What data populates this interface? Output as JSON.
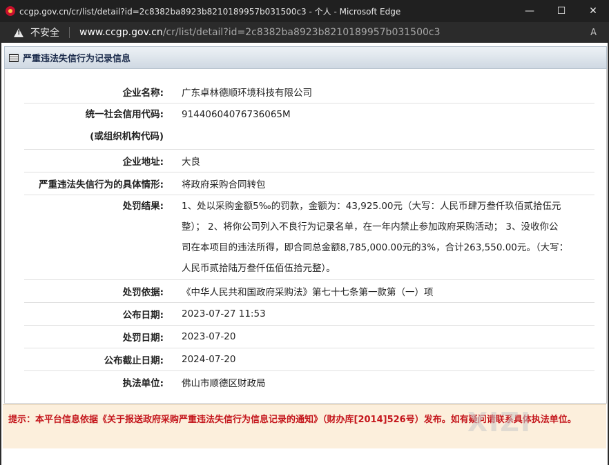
{
  "window": {
    "title": "ccgp.gov.cn/cr/list/detail?id=2c8382ba8923b8210189957b031500c3 - 个人 - Microsoft Edge",
    "minimize": "—",
    "maximize": "☐",
    "close": "✕"
  },
  "address_bar": {
    "security_text": "不安全",
    "url_host": "www.ccgp.gov.cn",
    "url_path": "/cr/list/detail?id=2c8382ba8923b8210189957b031500c3",
    "reader_icon": "A"
  },
  "panel": {
    "title": "严重违法失信行为记录信息"
  },
  "fields": {
    "company_label": "企业名称:",
    "company_value": "广东卓林德顺环境科技有限公司",
    "credit_label_1": "统一社会信用代码:",
    "credit_label_2": "(或组织机构代码)",
    "credit_value": "91440604076736065M",
    "address_label": "企业地址:",
    "address_value": "大良",
    "situation_label": "严重违法失信行为的具体情形:",
    "situation_value": "将政府采购合同转包",
    "result_label": "处罚结果:",
    "result_lines": [
      "1、处以采购金额5‰的罚款，金额为：43,925.00元（大写：人民币肆万叁仟玖佰贰拾伍元",
      "整）；  2、将你公司列入不良行为记录名单，在一年内禁止参加政府采购活动；  3、没收你公",
      "司在本项目的违法所得，即合同总金额8,785,000.00元的3%，合计263,550.00元。（大写：",
      "人民币贰拾陆万叁仟伍佰伍拾元整）。"
    ],
    "basis_label": "处罚依据:",
    "basis_value": "《中华人民共和国政府采购法》第七十七条第一款第（一）项",
    "publish_label": "公布日期:",
    "publish_value": "2023-07-27 11:53",
    "punish_date_label": "处罚日期:",
    "punish_date_value": "2023-07-20",
    "deadline_label": "公布截止日期:",
    "deadline_value": "2024-07-20",
    "unit_label": "执法单位:",
    "unit_value": "佛山市顺德区财政局"
  },
  "notice": {
    "text": "提示：本平台信息依据《关于报送政府采购严重违法失信行为信息记录的通知》（财办库[2014]526号）发布。如有疑问请联系具体执法单位。"
  },
  "watermark": "XIZI"
}
